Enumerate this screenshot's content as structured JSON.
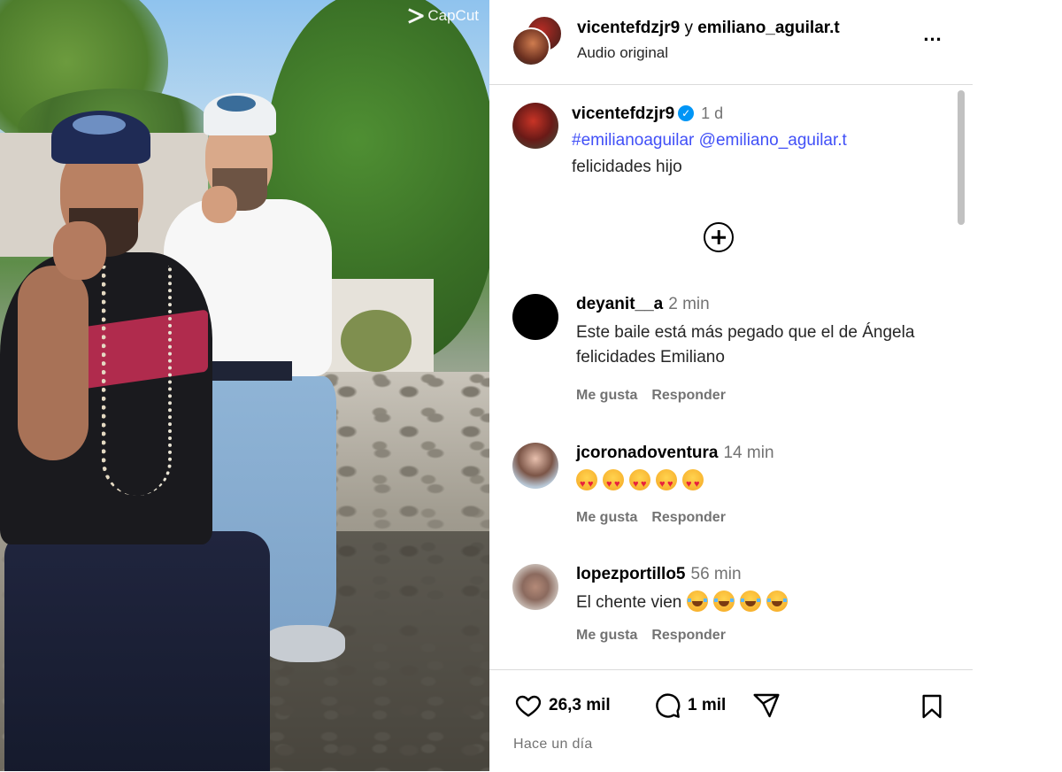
{
  "video": {
    "watermark": "CapCut"
  },
  "header": {
    "user_primary": "vicentefdzjr9",
    "conjunction": "y",
    "user_secondary": "emiliano_aguilar.t",
    "subtitle": "Audio original",
    "more_icon": "more-horizontal-icon",
    "more_label": "..."
  },
  "caption": {
    "username": "vicentefdzjr9",
    "verified_icon": "verified-badge-icon",
    "time": "1 d",
    "hashtag": "#emilianoaguilar",
    "mention": "@emiliano_aguilar.t",
    "text": "felicidades hijo"
  },
  "load_more_icon": "plus-circle-icon",
  "comments": [
    {
      "username": "deyanit__a",
      "time": "2 min",
      "text": "Este baile está más pegado que el de Ángela felicidades Emiliano",
      "like_label": "Me gusta",
      "reply_label": "Responder",
      "avatar_color": "#000000"
    },
    {
      "username": "jcoronadoventura",
      "time": "14 min",
      "emoji": "heart-eyes-emoji",
      "emoji_count": 5,
      "like_label": "Me gusta",
      "reply_label": "Responder"
    },
    {
      "username": "lopezportillo5",
      "time": "56 min",
      "text": "El chente vien",
      "emoji": "tears-of-joy-emoji",
      "emoji_count": 4,
      "like_label": "Me gusta",
      "reply_label": "Responder"
    }
  ],
  "footer": {
    "likes": "26,3 mil",
    "comments": "1 mil",
    "like_icon": "heart-icon",
    "comment_icon": "comment-icon",
    "share_icon": "send-icon",
    "save_icon": "bookmark-icon",
    "timestamp": "Hace un día"
  },
  "colors": {
    "link": "#4150f7",
    "verified": "#0095f6",
    "secondary_text": "#737373",
    "divider": "#dbdbdb"
  }
}
